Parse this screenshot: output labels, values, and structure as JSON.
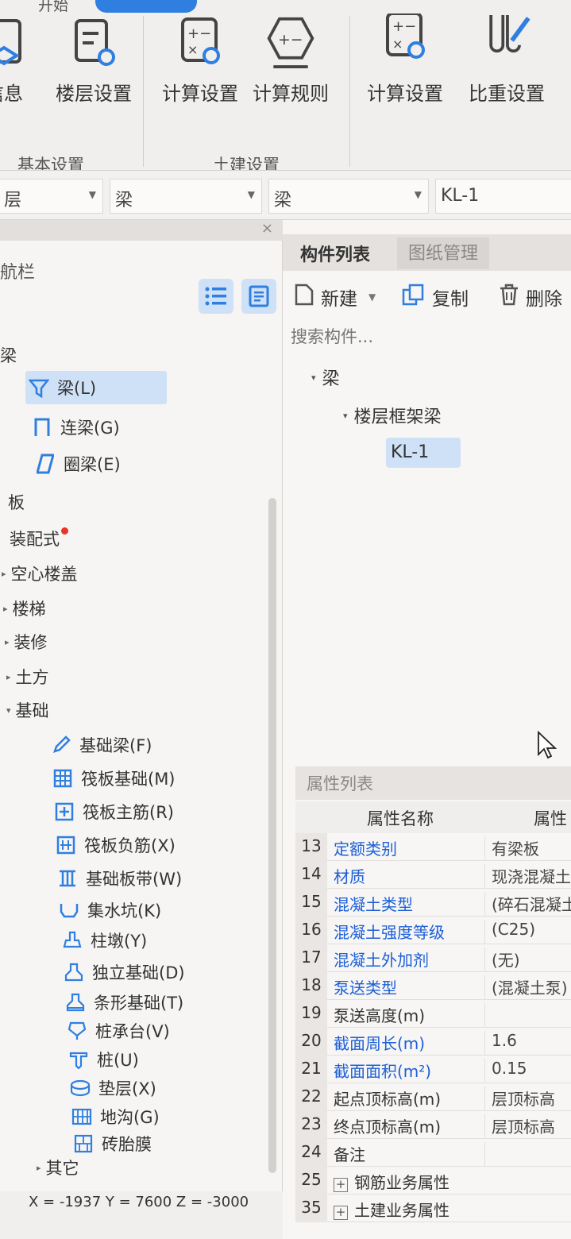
{
  "ribbon": {
    "tabs": {
      "start": "开始"
    },
    "buttons": [
      {
        "id": "info",
        "label": "信息"
      },
      {
        "id": "floor",
        "label": "楼层设置"
      },
      {
        "id": "calc1",
        "label": "计算设置"
      },
      {
        "id": "rules",
        "label": "计算规则"
      },
      {
        "id": "calc2",
        "label": "计算设置"
      },
      {
        "id": "density",
        "label": "比重设置"
      }
    ],
    "groups": {
      "basic": "基本设置",
      "civil": "土建设置"
    }
  },
  "selectors": {
    "layer": "层",
    "type1": "梁",
    "type2": "梁",
    "component": "KL-1"
  },
  "nav": {
    "title": "航栏",
    "tree": [
      {
        "label": "梁"
      },
      {
        "label": "梁(L)"
      },
      {
        "label": "连梁(G)"
      },
      {
        "label": "圈梁(E)"
      },
      {
        "label": "板"
      },
      {
        "label": "装配式"
      },
      {
        "label": "空心楼盖"
      },
      {
        "label": "楼梯"
      },
      {
        "label": "装修"
      },
      {
        "label": "土方"
      },
      {
        "label": "基础"
      },
      {
        "label": "基础梁(F)"
      },
      {
        "label": "筏板基础(M)"
      },
      {
        "label": "筏板主筋(R)"
      },
      {
        "label": "筏板负筋(X)"
      },
      {
        "label": "基础板带(W)"
      },
      {
        "label": "集水坑(K)"
      },
      {
        "label": "柱墩(Y)"
      },
      {
        "label": "独立基础(D)"
      },
      {
        "label": "条形基础(T)"
      },
      {
        "label": "桩承台(V)"
      },
      {
        "label": "桩(U)"
      },
      {
        "label": "垫层(X)"
      },
      {
        "label": "地沟(G)"
      },
      {
        "label": "砖胎膜"
      },
      {
        "label": "其它"
      }
    ]
  },
  "statusbar": {
    "coords": "X = -1937 Y = 7600 Z = -3000"
  },
  "components": {
    "tabs": {
      "list": "构件列表",
      "drawings": "图纸管理"
    },
    "toolbar": {
      "new": "新建",
      "copy": "复制",
      "delete": "删除"
    },
    "search": {
      "placeholder": "搜索构件..."
    },
    "tree": {
      "root": "梁",
      "group": "楼层框架梁",
      "item": "KL-1"
    }
  },
  "properties": {
    "title": "属性列表",
    "header": {
      "name": "属性名称",
      "value": "属性"
    },
    "rows": [
      {
        "no": "13",
        "name": "定额类别",
        "value": "有梁板"
      },
      {
        "no": "14",
        "name": "材质",
        "value": "现浇混凝土"
      },
      {
        "no": "15",
        "name": "混凝土类型",
        "value": "(碎石混凝土"
      },
      {
        "no": "16",
        "name": "混凝土强度等级",
        "value": "(C25)"
      },
      {
        "no": "17",
        "name": "混凝土外加剂",
        "value": "(无)"
      },
      {
        "no": "18",
        "name": "泵送类型",
        "value": "(混凝土泵)"
      },
      {
        "no": "19",
        "name": "泵送高度(m)",
        "value": ""
      },
      {
        "no": "20",
        "name": "截面周长(m)",
        "value": "1.6"
      },
      {
        "no": "21",
        "name": "截面面积(m²)",
        "value": "0.15"
      },
      {
        "no": "22",
        "name": "起点顶标高(m)",
        "value": "层顶标高"
      },
      {
        "no": "23",
        "name": "终点顶标高(m)",
        "value": "层顶标高"
      },
      {
        "no": "24",
        "name": "备注",
        "value": ""
      },
      {
        "no": "25",
        "name": "钢筋业务属性",
        "value": ""
      },
      {
        "no": "35",
        "name": "土建业务属性",
        "value": ""
      }
    ]
  },
  "colors": {
    "accent": "#2f7fe0",
    "selection": "#cfe1f6",
    "link": "#1d5fd6",
    "badge": "#e8342a"
  }
}
